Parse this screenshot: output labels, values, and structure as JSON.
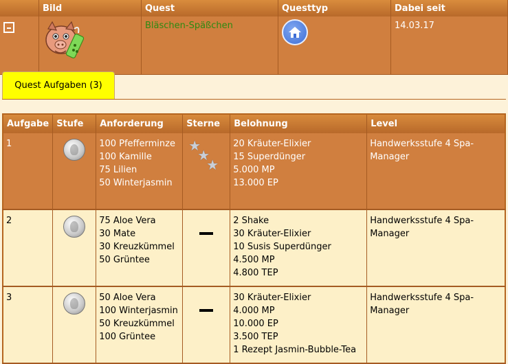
{
  "quest_table": {
    "headers": [
      "",
      "Bild",
      "Quest",
      "Questtyp",
      "Dabei seit"
    ],
    "row": {
      "quest_name": "Bläschen-Späßchen",
      "since": "14.03.17",
      "collapse_icon": "minus-box-icon",
      "image_icon": "pig-with-bubble-tea-icon",
      "type_icon": "house-icon"
    }
  },
  "tabs": [
    {
      "label": "Quest Aufgaben (3)",
      "active": true
    }
  ],
  "tasks": {
    "headers": [
      "Aufgabe",
      "Stufe",
      "Anforderung",
      "Sterne",
      "Belohnung",
      "Level"
    ],
    "rows": [
      {
        "nr": "1",
        "stufe_icon": "silver-coin-icon",
        "anforderung": [
          "100 Pfefferminze",
          "100 Kamille",
          "75 Lilien",
          "50 Winterjasmin"
        ],
        "sterne": 3,
        "belohnung": [
          "20 Kräuter-Elixier",
          "15 Superdünger",
          "5.000 MP",
          "13.000 EP"
        ],
        "level": "Handwerksstufe 4 Spa-Manager"
      },
      {
        "nr": "2",
        "stufe_icon": "silver-coin-icon",
        "anforderung": [
          "75 Aloe Vera",
          "30 Mate",
          "30 Kreuzkümmel",
          "50 Grüntee"
        ],
        "sterne": 0,
        "belohnung": [
          "2 Shake",
          "30 Kräuter-Elixier",
          "10 Susis Superdünger",
          "4.500 MP",
          "4.800 TEP"
        ],
        "level": "Handwerksstufe 4 Spa-Manager"
      },
      {
        "nr": "3",
        "stufe_icon": "silver-coin-icon",
        "anforderung": [
          "50 Aloe Vera",
          "100 Winterjasmin",
          "50 Kreuzkümmel",
          "100 Grüntee"
        ],
        "sterne": 0,
        "belohnung": [
          "30 Kräuter-Elixier",
          "4.000 MP",
          "10.000 EP",
          "3.500 TEP",
          "1 Rezept Jasmin-Bubble-Tea"
        ],
        "level": "Handwerksstufe 4 Spa-Manager"
      }
    ]
  },
  "colors": {
    "header": "#c67a35",
    "row_orange": "#d07f3f",
    "row_cream": "#fdf0c8",
    "tab_active": "#ffff00",
    "quest_name": "#2d8a12"
  }
}
